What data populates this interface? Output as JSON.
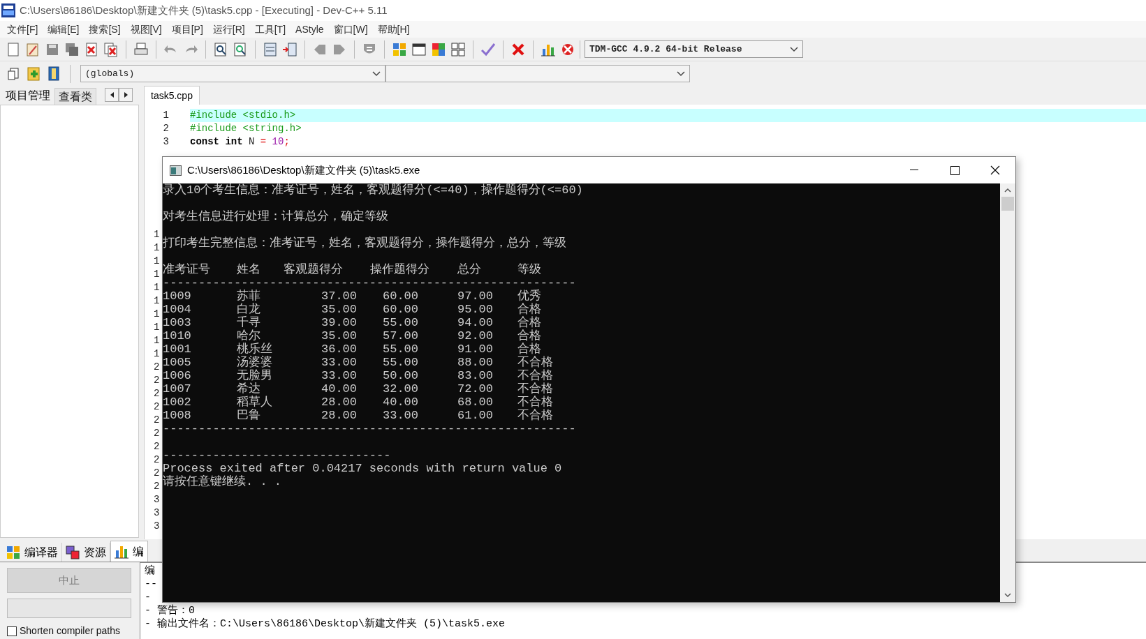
{
  "window": {
    "title": "C:\\Users\\86186\\Desktop\\新建文件夹 (5)\\task5.cpp - [Executing] - Dev-C++ 5.11"
  },
  "menu": [
    "文件[F]",
    "编辑[E]",
    "搜索[S]",
    "视图[V]",
    "项目[P]",
    "运行[R]",
    "工具[T]",
    "AStyle",
    "窗口[W]",
    "帮助[H]"
  ],
  "compiler_select": {
    "value": "TDM-GCC 4.9.2 64-bit Release"
  },
  "scope_select": {
    "value": "(globals)"
  },
  "left_panel": {
    "tabs": [
      {
        "label": "项目管理",
        "selected": true
      },
      {
        "label": "查看类",
        "selected": false
      }
    ]
  },
  "editor": {
    "tabs": [
      {
        "label": "task5.cpp",
        "selected": true
      }
    ],
    "lines": [
      {
        "number": "1",
        "highlighted": true,
        "tokens": [
          {
            "kind": "preprocessor",
            "text": "#include <stdio.h>"
          }
        ]
      },
      {
        "number": "2",
        "highlighted": false,
        "tokens": [
          {
            "kind": "preprocessor",
            "text": "#include <string.h>"
          }
        ]
      },
      {
        "number": "3",
        "highlighted": false,
        "tokens": [
          {
            "kind": "keyword",
            "text": "const",
            "spaced": false
          },
          {
            "kind": "keyword",
            "text": "int",
            "spaced": true
          },
          {
            "kind": "plain",
            "text": "N",
            "spaced": true
          },
          {
            "kind": "symbol",
            "text": "=",
            "spaced": true
          },
          {
            "kind": "number",
            "text": "10",
            "spaced": true
          },
          {
            "kind": "symbol",
            "text": ";",
            "spaced": false
          }
        ]
      }
    ],
    "gutter_fragments": [
      "1",
      "1",
      "1",
      "1",
      "1",
      "1",
      "1",
      "1",
      "1",
      "1",
      "2",
      "2",
      "2",
      "2",
      "2",
      "2",
      "2",
      "2",
      "2",
      "2",
      "3",
      "3",
      "3"
    ]
  },
  "console": {
    "title": "C:\\Users\\86186\\Desktop\\新建文件夹 (5)\\task5.exe",
    "lines": [
      {
        "kind": "text",
        "text": "录入10个考生信息：准考证号，姓名，客观题得分(<=40)，操作题得分(<=60)"
      },
      {
        "kind": "blank"
      },
      {
        "kind": "text",
        "text": "对考生信息进行处理：计算总分，确定等级"
      },
      {
        "kind": "blank"
      },
      {
        "kind": "text",
        "text": "打印考生完整信息：准考证号，姓名，客观题得分，操作题得分，总分，等级"
      },
      {
        "kind": "blank"
      },
      {
        "kind": "header",
        "cells": [
          "准考证号",
          "姓名",
          "客观题得分",
          "操作题得分",
          "总分",
          "等级"
        ]
      },
      {
        "kind": "text",
        "text": "----------------------------------------------------------"
      },
      {
        "kind": "row",
        "cells": [
          "1009",
          "苏菲",
          "37.00",
          "60.00",
          "97.00",
          "优秀"
        ]
      },
      {
        "kind": "row",
        "cells": [
          "1004",
          "白龙",
          "35.00",
          "60.00",
          "95.00",
          "合格"
        ]
      },
      {
        "kind": "row",
        "cells": [
          "1003",
          "千寻",
          "39.00",
          "55.00",
          "94.00",
          "合格"
        ]
      },
      {
        "kind": "row",
        "cells": [
          "1010",
          "哈尔",
          "35.00",
          "57.00",
          "92.00",
          "合格"
        ]
      },
      {
        "kind": "row",
        "cells": [
          "1001",
          "桃乐丝",
          "36.00",
          "55.00",
          "91.00",
          "合格"
        ]
      },
      {
        "kind": "row",
        "cells": [
          "1005",
          "汤婆婆",
          "33.00",
          "55.00",
          "88.00",
          "不合格"
        ]
      },
      {
        "kind": "row",
        "cells": [
          "1006",
          "无脸男",
          "33.00",
          "50.00",
          "83.00",
          "不合格"
        ]
      },
      {
        "kind": "row",
        "cells": [
          "1007",
          "希达",
          "40.00",
          "32.00",
          "72.00",
          "不合格"
        ]
      },
      {
        "kind": "row",
        "cells": [
          "1002",
          "稻草人",
          "28.00",
          "40.00",
          "68.00",
          "不合格"
        ]
      },
      {
        "kind": "row",
        "cells": [
          "1008",
          "巴鲁",
          "28.00",
          "33.00",
          "61.00",
          "不合格"
        ]
      },
      {
        "kind": "text",
        "text": "----------------------------------------------------------"
      },
      {
        "kind": "blank"
      },
      {
        "kind": "text",
        "text": "--------------------------------"
      },
      {
        "kind": "text",
        "text": "Process exited after 0.04217 seconds with return value 0"
      },
      {
        "kind": "text",
        "text": "请按任意键继续. . ."
      }
    ]
  },
  "bottom_panel": {
    "tabs": [
      {
        "label": "编译器",
        "selected": false
      },
      {
        "label": "资源",
        "selected": false
      },
      {
        "label": "编",
        "selected": true
      }
    ],
    "abort_button": {
      "label": "中止",
      "disabled": true
    },
    "shorten_paths": {
      "label": "Shorten compiler paths",
      "checked": false
    },
    "log": [
      "编",
      "--",
      "-",
      "- 警告：0",
      "- 输出文件名：C:\\Users\\86186\\Desktop\\新建文件夹 (5)\\task5.exe"
    ]
  }
}
